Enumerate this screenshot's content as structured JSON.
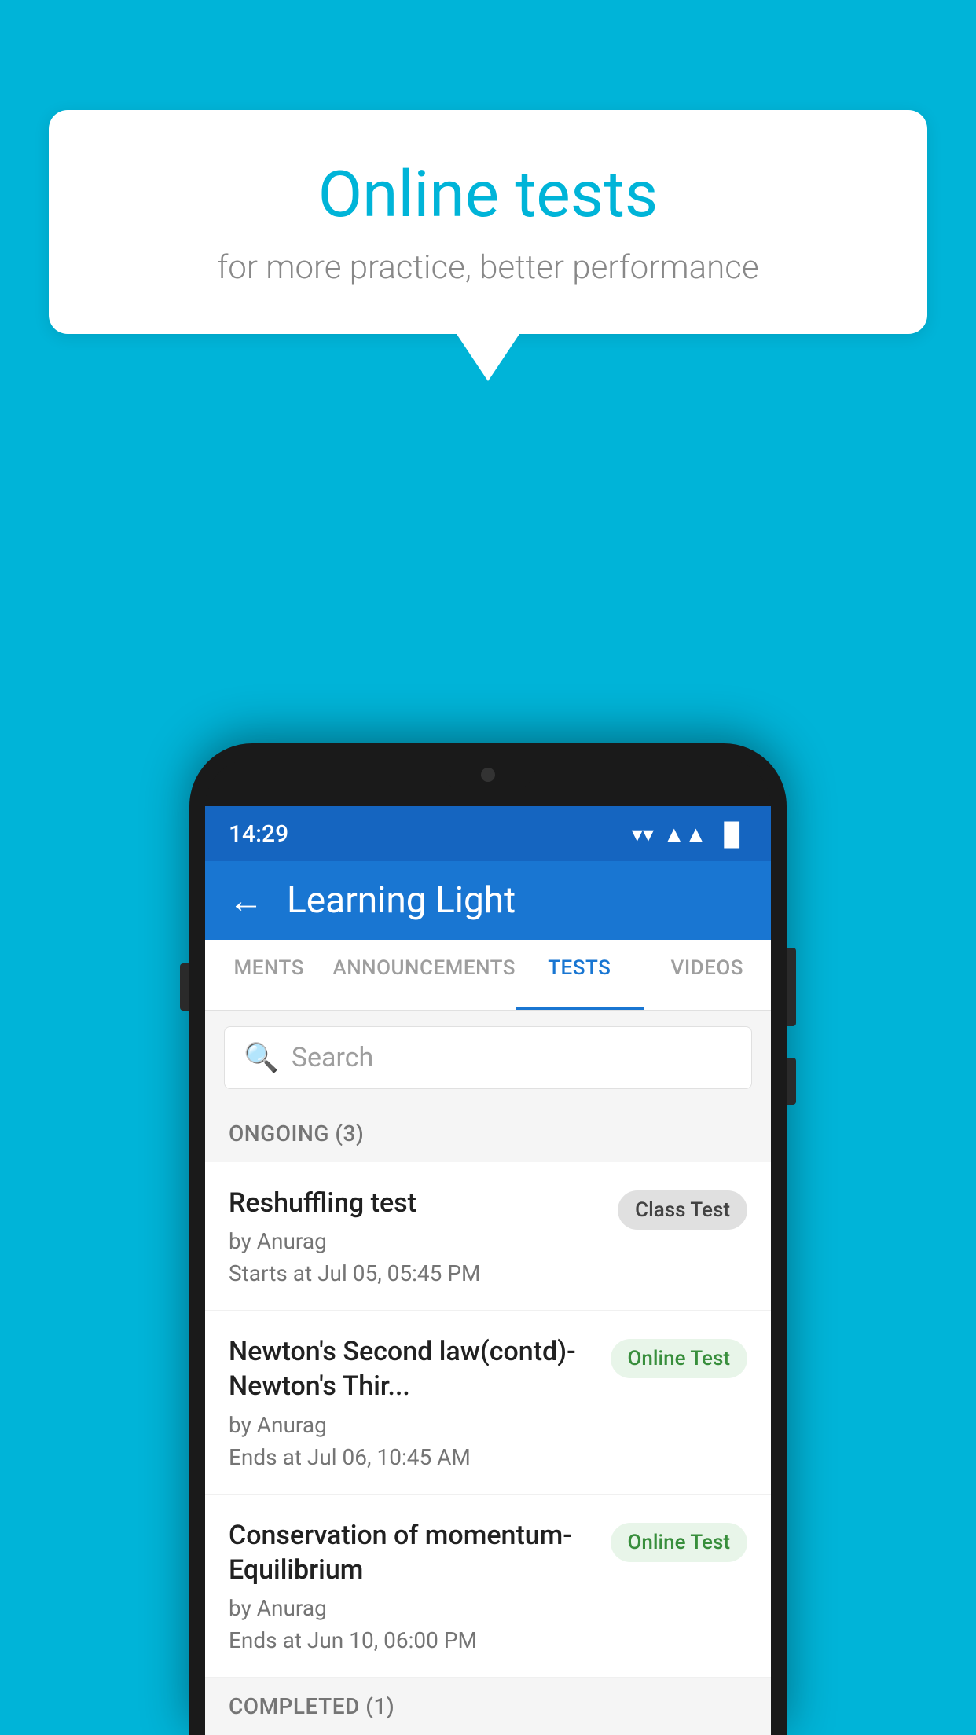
{
  "background_color": "#00b4d8",
  "bubble": {
    "title": "Online tests",
    "subtitle": "for more practice, better performance"
  },
  "phone": {
    "status_bar": {
      "time": "14:29",
      "wifi": "▲",
      "signal": "▲",
      "battery": "▐"
    },
    "header": {
      "back_label": "←",
      "title": "Learning Light"
    },
    "tabs": [
      {
        "label": "MENTS",
        "active": false
      },
      {
        "label": "ANNOUNCEMENTS",
        "active": false
      },
      {
        "label": "TESTS",
        "active": true
      },
      {
        "label": "VIDEOS",
        "active": false
      }
    ],
    "search": {
      "placeholder": "Search"
    },
    "ongoing_section": {
      "label": "ONGOING (3)"
    },
    "tests": [
      {
        "name": "Reshuffling test",
        "author": "by Anurag",
        "time_label": "Starts at",
        "time": "Jul 05, 05:45 PM",
        "badge": "Class Test",
        "badge_type": "class"
      },
      {
        "name": "Newton's Second law(contd)-Newton's Thir...",
        "author": "by Anurag",
        "time_label": "Ends at",
        "time": "Jul 06, 10:45 AM",
        "badge": "Online Test",
        "badge_type": "online"
      },
      {
        "name": "Conservation of momentum-Equilibrium",
        "author": "by Anurag",
        "time_label": "Ends at",
        "time": "Jun 10, 06:00 PM",
        "badge": "Online Test",
        "badge_type": "online"
      }
    ],
    "completed_section": {
      "label": "COMPLETED (1)"
    }
  }
}
